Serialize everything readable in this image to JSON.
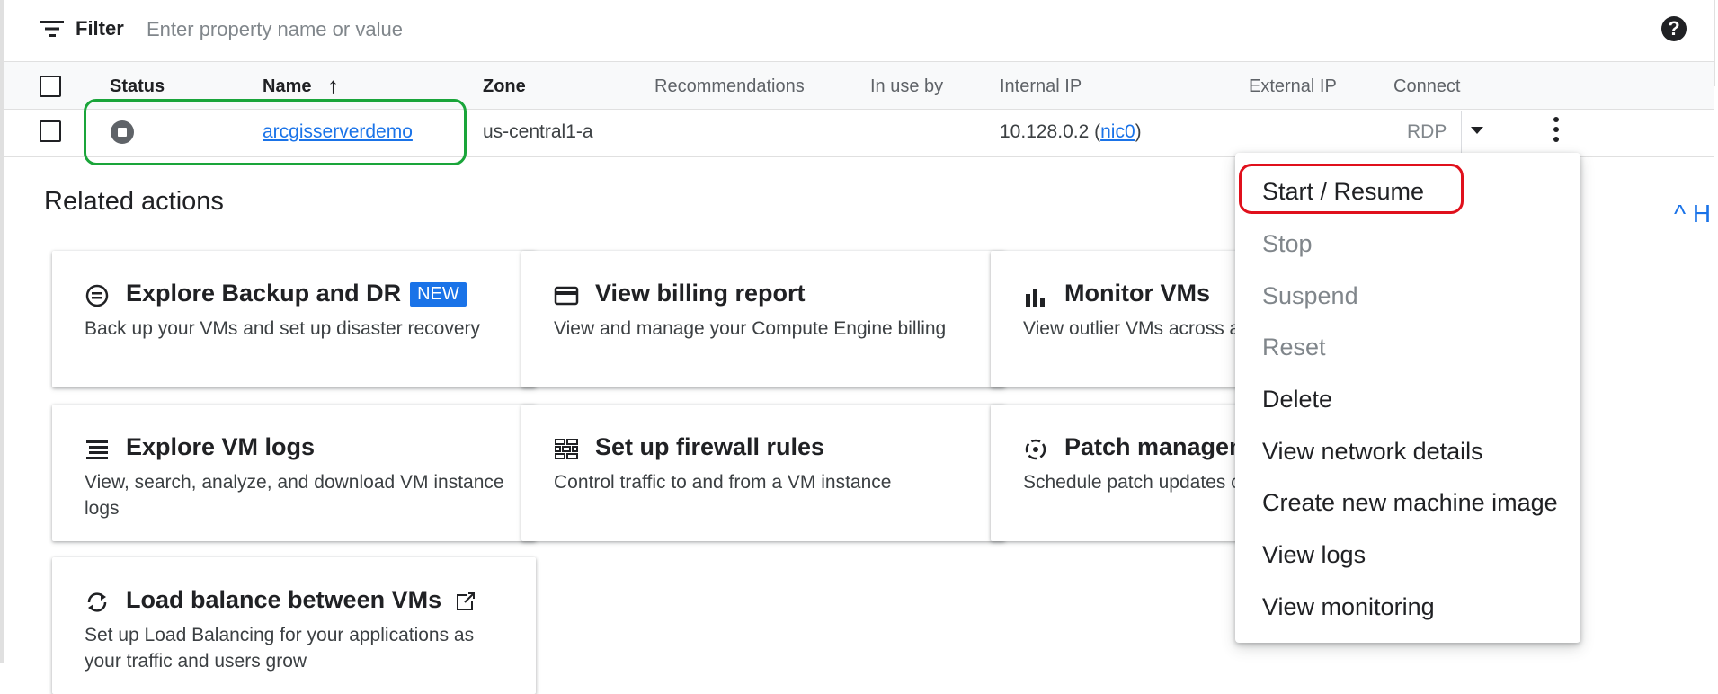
{
  "filter": {
    "label": "Filter",
    "placeholder": "Enter property name or value",
    "help": "?"
  },
  "table": {
    "columns": {
      "status": "Status",
      "name": "Name",
      "name_sort": "↑",
      "zone": "Zone",
      "recommendations": "Recommendations",
      "in_use_by": "In use by",
      "internal_ip": "Internal IP",
      "external_ip": "External IP",
      "connect": "Connect"
    },
    "row": {
      "name": "arcgisserverdemo",
      "zone": "us-central1-a",
      "internal_ip_prefix": "10.128.0.2 (",
      "nic": "nic0",
      "internal_ip_suffix": ")",
      "connect": "RDP"
    }
  },
  "related": {
    "title": "Related actions",
    "collapse": "^ H",
    "cards": [
      {
        "title": "Explore Backup and DR",
        "badge": "NEW",
        "desc": "Back up your VMs and set up disaster recovery",
        "icon": "backup-icon"
      },
      {
        "title": "View billing report",
        "desc": "View and manage your Compute Engine billing",
        "icon": "billing-card-icon"
      },
      {
        "title": "Monitor VMs",
        "desc": "View outlier VMs across and network",
        "icon": "bar-chart-icon"
      },
      {
        "title": "Explore VM logs",
        "desc": "View, search, analyze, and download VM instance logs",
        "icon": "logs-icon"
      },
      {
        "title": "Set up firewall rules",
        "desc": "Control traffic to and from a VM instance",
        "icon": "firewall-icon"
      },
      {
        "title": "Patch managem",
        "desc": "Schedule patch updates compliance on VM instar",
        "icon": "patch-icon"
      },
      {
        "title": "Load balance between VMs",
        "desc": "Set up Load Balancing for your applications as your traffic and users grow",
        "icon": "sync-icon"
      }
    ]
  },
  "menu": {
    "items": [
      {
        "label": "Start / Resume",
        "enabled": true
      },
      {
        "label": "Stop",
        "enabled": false
      },
      {
        "label": "Suspend",
        "enabled": false
      },
      {
        "label": "Reset",
        "enabled": false
      },
      {
        "label": "Delete",
        "enabled": true
      },
      {
        "label": "View network details",
        "enabled": true
      },
      {
        "label": "Create new machine image",
        "enabled": true
      },
      {
        "label": "View logs",
        "enabled": true
      },
      {
        "label": "View monitoring",
        "enabled": true
      }
    ]
  },
  "colors": {
    "accent": "#1a73e8",
    "highlight_green": "#1aa53a",
    "highlight_red": "#e0101c"
  }
}
